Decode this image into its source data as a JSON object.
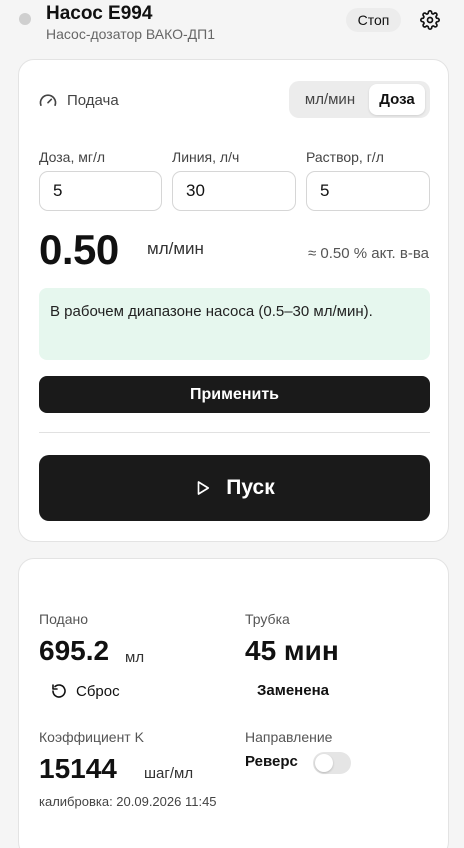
{
  "header": {
    "title": "Насос E994",
    "subtitle": "Насос-дозатор ВАКО-ДП1",
    "stop_label": "Стоп"
  },
  "feed": {
    "label": "Подача",
    "mode_options": [
      "мл/мин",
      "Доза"
    ],
    "mode_selected": "Доза",
    "fields": [
      {
        "label": "Доза, мг/л",
        "value": "5"
      },
      {
        "label": "Линия, л/ч",
        "value": "30"
      },
      {
        "label": "Раствор, г/л",
        "value": "5"
      }
    ],
    "rate_value": "0.50",
    "rate_unit": "мл/мин",
    "concentration": "≈ 0.50 % акт. в-ва",
    "info_text": "В рабочем диапазоне насоса (0.5–30 мл/мин).",
    "apply_label": "Применить",
    "start_label": "Пуск"
  },
  "stats": {
    "delivered_label": "Подано",
    "delivered_value": "695.2",
    "delivered_unit": "мл",
    "reset_label": "Сброс",
    "tube_label": "Трубка",
    "tube_value": "45 мин",
    "tube_status": "Заменена",
    "coef_label": "Коэффициент K",
    "coef_value": "15144",
    "coef_unit": "шаг/мл",
    "direction_label": "Направление",
    "reverse_label": "Реверс",
    "reverse_on": false,
    "calibration": "калибровка: 20.09.2026 11:45"
  },
  "icons": {
    "status": "status-dot",
    "settings": "gear-icon",
    "feed": "gauge-icon",
    "start": "play-icon",
    "reset": "refresh-icon"
  }
}
